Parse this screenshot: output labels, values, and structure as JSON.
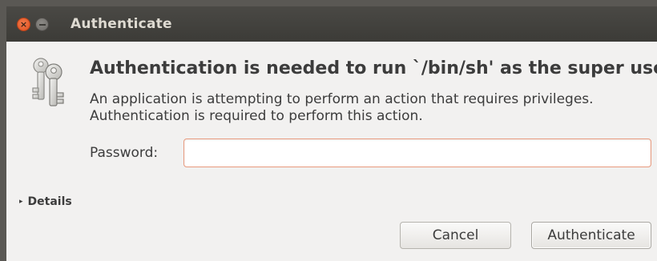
{
  "window": {
    "title": "Authenticate",
    "close_glyph": "×",
    "icons": {
      "close": "close-icon",
      "minimize": "minimize-icon",
      "dialog": "keys-icon"
    }
  },
  "dialog": {
    "heading": "Authentication is needed to run `/bin/sh' as the super user",
    "message": "An application is attempting to perform an action that requires privileges. Authentication is required to perform this action.",
    "password_label": "Password:",
    "password_value": "",
    "details_arrow": "▸",
    "details_label": "Details",
    "cancel_label": "Cancel",
    "authenticate_label": "Authenticate"
  },
  "colors": {
    "titlebar": "#3c3b37",
    "close_button": "#e0501e",
    "input_focus_border": "#e89a7e",
    "dialog_background": "#f2f1f0"
  }
}
